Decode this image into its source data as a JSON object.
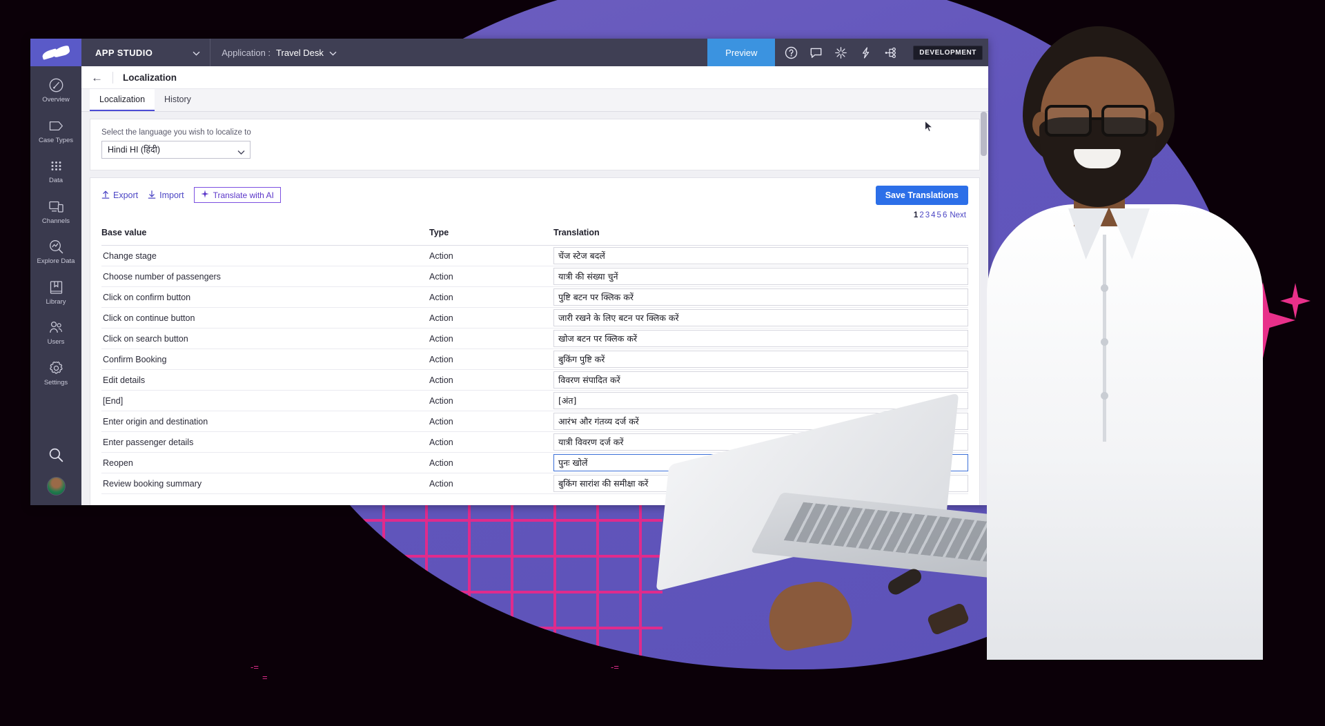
{
  "header": {
    "logo": "pega-logo-icon",
    "studio_label": "APP STUDIO",
    "studio_caret": "chevron-down-icon",
    "application_label": "Application :",
    "application_value": "Travel Desk",
    "application_caret": "chevron-down-icon",
    "preview_label": "Preview",
    "icons": [
      {
        "name": "help-icon",
        "glyph": "?"
      },
      {
        "name": "feedback-chat-icon",
        "glyph": "chat"
      },
      {
        "name": "sparkle-ai-icon",
        "glyph": "sparkle"
      },
      {
        "name": "lightning-icon",
        "glyph": "bolt"
      },
      {
        "name": "branch-share-icon",
        "glyph": "branch"
      }
    ],
    "environment_badge": "DEVELOPMENT",
    "accent_preview": "#3B93E0",
    "accent_logo_bg": "#5A5AC8",
    "bar_bg": "#3F3F54"
  },
  "sidebar": {
    "items": [
      {
        "label": "Overview",
        "icon": "gauge-icon"
      },
      {
        "label": "Case Types",
        "icon": "case-type-icon"
      },
      {
        "label": "Data",
        "icon": "data-grid-icon"
      },
      {
        "label": "Channels",
        "icon": "channels-icon"
      },
      {
        "label": "Explore Data",
        "icon": "explore-data-icon"
      },
      {
        "label": "Library",
        "icon": "library-book-icon"
      },
      {
        "label": "Users",
        "icon": "users-icon"
      },
      {
        "label": "Settings",
        "icon": "gear-icon"
      }
    ],
    "search_icon": "search-icon",
    "avatar": "user-avatar"
  },
  "page": {
    "back_icon": "back-arrow-icon",
    "title": "Localization",
    "tabs": [
      {
        "label": "Localization",
        "active": true
      },
      {
        "label": "History",
        "active": false
      }
    ]
  },
  "language_panel": {
    "label": "Select the language you wish to localize to",
    "selected": "Hindi HI (हिंदी)",
    "caret": "chevron-down-icon"
  },
  "toolbar": {
    "export_label": "Export",
    "export_icon": "upload-arrow-icon",
    "import_label": "Import",
    "import_icon": "download-arrow-icon",
    "translate_ai_label": "Translate with AI",
    "translate_ai_icon": "sparkle-icon",
    "save_label": "Save Translations"
  },
  "pagination": {
    "pages": [
      "1",
      "2",
      "3",
      "4",
      "5",
      "6"
    ],
    "current": "1",
    "next_label": "Next"
  },
  "table": {
    "columns": [
      "Base value",
      "Type",
      "Translation"
    ],
    "rows": [
      {
        "base": "Change stage",
        "type": "Action",
        "translation": "चेंज स्टेज बदलें",
        "focused": false
      },
      {
        "base": "Choose number of passengers",
        "type": "Action",
        "translation": "यात्री की संख्या चुनें",
        "focused": false
      },
      {
        "base": "Click on confirm button",
        "type": "Action",
        "translation": "पुष्टि बटन पर क्लिक करें",
        "focused": false
      },
      {
        "base": "Click on continue button",
        "type": "Action",
        "translation": "जारी रखने के लिए बटन पर क्लिक करें",
        "focused": false
      },
      {
        "base": "Click on search button",
        "type": "Action",
        "translation": "खोज बटन पर क्लिक करें",
        "focused": false
      },
      {
        "base": "Confirm Booking",
        "type": "Action",
        "translation": "बुकिंग पुष्टि करें",
        "focused": false
      },
      {
        "base": "Edit details",
        "type": "Action",
        "translation": "विवरण संपादित करें",
        "focused": false
      },
      {
        "base": "[End]",
        "type": "Action",
        "translation": "[अंत]",
        "focused": false
      },
      {
        "base": "Enter origin and destination",
        "type": "Action",
        "translation": "आरंभ और गंतव्य दर्ज करें",
        "focused": false
      },
      {
        "base": "Enter passenger details",
        "type": "Action",
        "translation": "यात्री विवरण दर्ज करें",
        "focused": false
      },
      {
        "base": "Reopen",
        "type": "Action",
        "translation": "पुनः खोलें",
        "focused": true
      },
      {
        "base": "Review booking summary",
        "type": "Action",
        "translation": "बुकिंग सारांश की समीक्षा करें",
        "focused": false
      }
    ]
  },
  "decor": {
    "blob_color": "#6256BC",
    "grid_color": "#E02B8C",
    "sparkle_color": "#E8308A",
    "page_bg": "#0B0008",
    "tick_marks": [
      "-=",
      "=",
      "-="
    ]
  }
}
